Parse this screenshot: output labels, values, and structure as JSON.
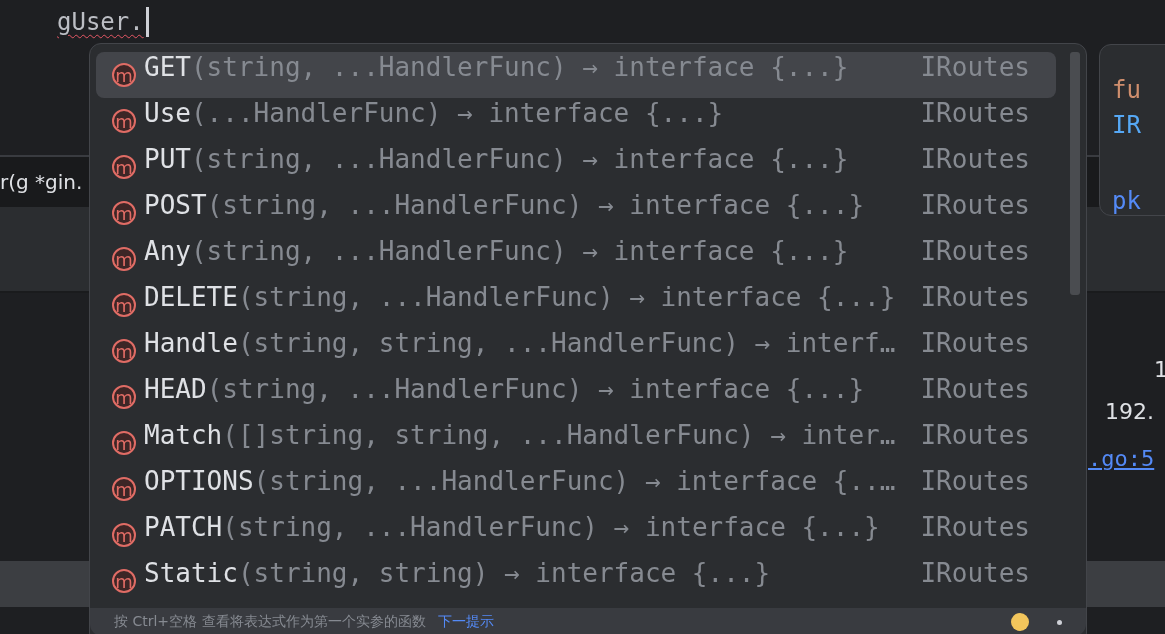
{
  "editor": {
    "typed_text": "gUser.",
    "error_underline": true,
    "fragment_signature": "r(g *gin."
  },
  "completion": {
    "items": [
      {
        "badge": "m",
        "name": "GET",
        "signature": "(string, ...HandlerFunc) → interface {...}",
        "type_text": "IRoutes",
        "selected": true
      },
      {
        "badge": "m",
        "name": "Use",
        "signature": "(...HandlerFunc) → interface {...}",
        "type_text": "IRoutes",
        "selected": false
      },
      {
        "badge": "m",
        "name": "PUT",
        "signature": "(string, ...HandlerFunc) → interface {...}",
        "type_text": "IRoutes",
        "selected": false
      },
      {
        "badge": "m",
        "name": "POST",
        "signature": "(string, ...HandlerFunc) → interface {...}",
        "type_text": "IRoutes",
        "selected": false
      },
      {
        "badge": "m",
        "name": "Any",
        "signature": "(string, ...HandlerFunc) → interface {...}",
        "type_text": "IRoutes",
        "selected": false
      },
      {
        "badge": "m",
        "name": "DELETE",
        "signature": "(string, ...HandlerFunc) → interface {...}",
        "type_text": "IRoutes",
        "selected": false
      },
      {
        "badge": "m",
        "name": "Handle",
        "signature": "(string, string, ...HandlerFunc) → interf…",
        "type_text": "IRoutes",
        "selected": false
      },
      {
        "badge": "m",
        "name": "HEAD",
        "signature": "(string, ...HandlerFunc) → interface {...}",
        "type_text": "IRoutes",
        "selected": false
      },
      {
        "badge": "m",
        "name": "Match",
        "signature": "([]string, string, ...HandlerFunc) → inter…",
        "type_text": "IRoutes",
        "selected": false
      },
      {
        "badge": "m",
        "name": "OPTIONS",
        "signature": "(string, ...HandlerFunc) → interface {..…",
        "type_text": "IRoutes",
        "selected": false
      },
      {
        "badge": "m",
        "name": "PATCH",
        "signature": "(string, ...HandlerFunc) → interface {...}",
        "type_text": "IRoutes",
        "selected": false
      },
      {
        "badge": "m",
        "name": "Static",
        "signature": "(string, string) → interface {...}",
        "type_text": "IRoutes",
        "selected": false
      }
    ],
    "footer": {
      "hint": "按 Ctrl+空格 查看将表达式作为第一个实参的函数",
      "link": "下一提示"
    }
  },
  "doc_popup": {
    "keyword": "fu",
    "type_name": "IR",
    "package": "pk"
  },
  "console": {
    "line_1": "1",
    "line_2": "192.",
    "link": ".go:5"
  }
}
